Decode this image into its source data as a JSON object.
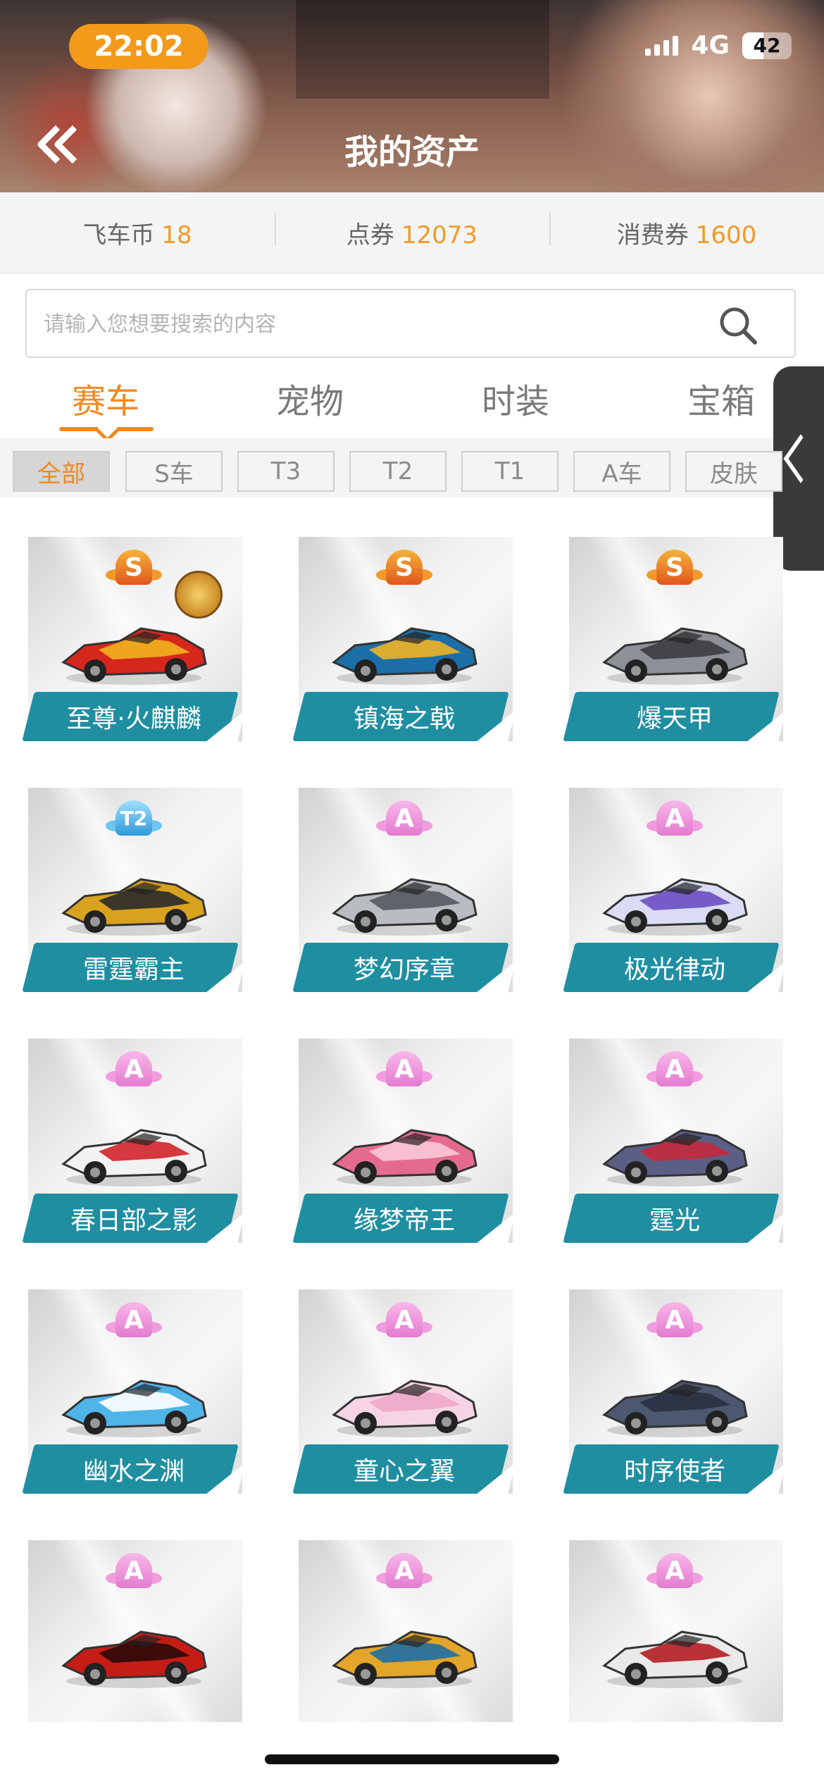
{
  "status_bar": {
    "time": "22:02",
    "network": "4G",
    "battery": "42"
  },
  "header": {
    "title": "我的资产",
    "back_icon": "double-chevron-left-icon"
  },
  "balances": [
    {
      "label": "飞车币",
      "value": "18"
    },
    {
      "label": "点券",
      "value": "12073"
    },
    {
      "label": "消费券",
      "value": "1600"
    }
  ],
  "search": {
    "placeholder": "请输入您想要搜索的内容",
    "icon": "search-icon"
  },
  "tabs": [
    {
      "label": "赛车",
      "active": true
    },
    {
      "label": "宠物",
      "active": false
    },
    {
      "label": "时装",
      "active": false
    },
    {
      "label": "宝箱",
      "active": false
    }
  ],
  "filters": [
    {
      "label": "全部",
      "active": true
    },
    {
      "label": "S车",
      "active": false
    },
    {
      "label": "T3",
      "active": false
    },
    {
      "label": "T2",
      "active": false
    },
    {
      "label": "T1",
      "active": false
    },
    {
      "label": "A车",
      "active": false
    },
    {
      "label": "皮肤",
      "active": false
    }
  ],
  "cars": [
    {
      "name": "至尊·火麒麟",
      "grade": "S",
      "medal": true,
      "color": "#d6271d",
      "accent": "#f1b21e"
    },
    {
      "name": "镇海之戟",
      "grade": "S",
      "medal": false,
      "color": "#1c6fa6",
      "accent": "#f0b326"
    },
    {
      "name": "爆天甲",
      "grade": "S",
      "medal": false,
      "color": "#8d9097",
      "accent": "#3b3d42"
    },
    {
      "name": "雷霆霸主",
      "grade": "T2",
      "medal": false,
      "color": "#d8a21f",
      "accent": "#2a2a2a"
    },
    {
      "name": "梦幻序章",
      "grade": "A",
      "medal": false,
      "color": "#b9bcc1",
      "accent": "#555a60"
    },
    {
      "name": "极光律动",
      "grade": "A",
      "medal": false,
      "color": "#d9dcf2",
      "accent": "#6a4ec2"
    },
    {
      "name": "春日部之影",
      "grade": "A",
      "medal": false,
      "color": "#f2f2f2",
      "accent": "#d1242a"
    },
    {
      "name": "缘梦帝王",
      "grade": "A",
      "medal": false,
      "color": "#e56b8e",
      "accent": "#f8c9d6"
    },
    {
      "name": "霆光",
      "grade": "A",
      "medal": false,
      "color": "#5b5f86",
      "accent": "#c42a3c"
    },
    {
      "name": "幽水之渊",
      "grade": "A",
      "medal": false,
      "color": "#4fb4e8",
      "accent": "#ffffff"
    },
    {
      "name": "童心之翼",
      "grade": "A",
      "medal": false,
      "color": "#f6d4e4",
      "accent": "#f0a8c8"
    },
    {
      "name": "时序使者",
      "grade": "A",
      "medal": false,
      "color": "#4b5870",
      "accent": "#2a3142"
    },
    {
      "name": "",
      "grade": "A",
      "medal": false,
      "color": "#c51d16",
      "accent": "#2a0a08"
    },
    {
      "name": "",
      "grade": "A",
      "medal": false,
      "color": "#e3a52a",
      "accent": "#1e6fa3"
    },
    {
      "name": "",
      "grade": "A",
      "medal": false,
      "color": "#e9e9e9",
      "accent": "#b31e22"
    }
  ]
}
